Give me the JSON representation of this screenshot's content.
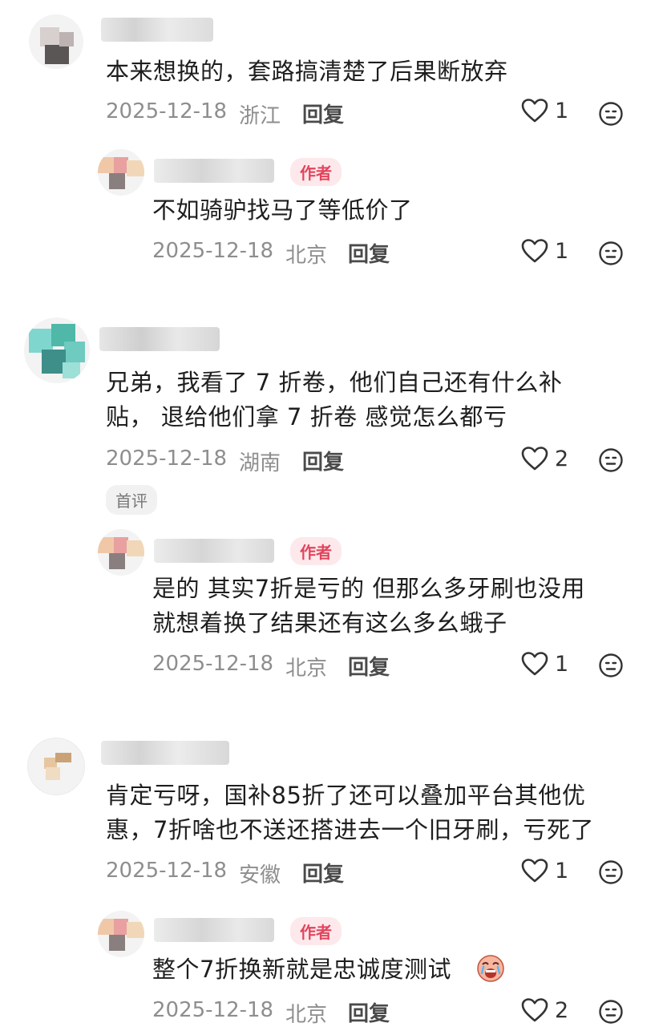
{
  "comments": [
    {
      "text_lines": [
        "本来想换的，套路搞清楚了后果断放弃"
      ],
      "date": "2025-12-18",
      "location": "浙江",
      "reply_label": "回复",
      "likes": "1"
    },
    {
      "badge": "作者",
      "text_lines": [
        "不如骑驴找马了等低价了"
      ],
      "date": "2025-12-18",
      "location": "北京",
      "reply_label": "回复",
      "likes": "1"
    },
    {
      "text_lines": [
        "兄弟，我看了 7 折卷，他们自己还有什么补",
        "贴， 退给他们拿 7 折卷 感觉怎么都亏"
      ],
      "date": "2025-12-18",
      "location": "湖南",
      "reply_label": "回复",
      "likes": "2",
      "tag": "首评"
    },
    {
      "badge": "作者",
      "text_lines": [
        "是的 其实7折是亏的 但那么多牙刷也没用",
        "就想着换了结果还有这么多幺蛾子"
      ],
      "date": "2025-12-18",
      "location": "北京",
      "reply_label": "回复",
      "likes": "1"
    },
    {
      "text_lines": [
        "肯定亏呀，国补85折了还可以叠加平台其他优",
        "惠，7折啥也不送还搭进去一个旧牙刷，亏死了"
      ],
      "date": "2025-12-18",
      "location": "安徽",
      "reply_label": "回复",
      "likes": "1"
    },
    {
      "badge": "作者",
      "text_lines": [
        "整个7折换新就是忠诚度测试"
      ],
      "date": "2025-12-18",
      "location": "北京",
      "reply_label": "回复",
      "likes": "2"
    }
  ],
  "icons": {
    "like": "heart-outline-icon",
    "emoji": "neutral-face-icon",
    "inline_emoji": "crying-face-emoji"
  },
  "colors": {
    "author_badge_bg": "#fde9ec",
    "author_badge_text": "#e2445c",
    "meta_text": "#8e8e8e"
  }
}
